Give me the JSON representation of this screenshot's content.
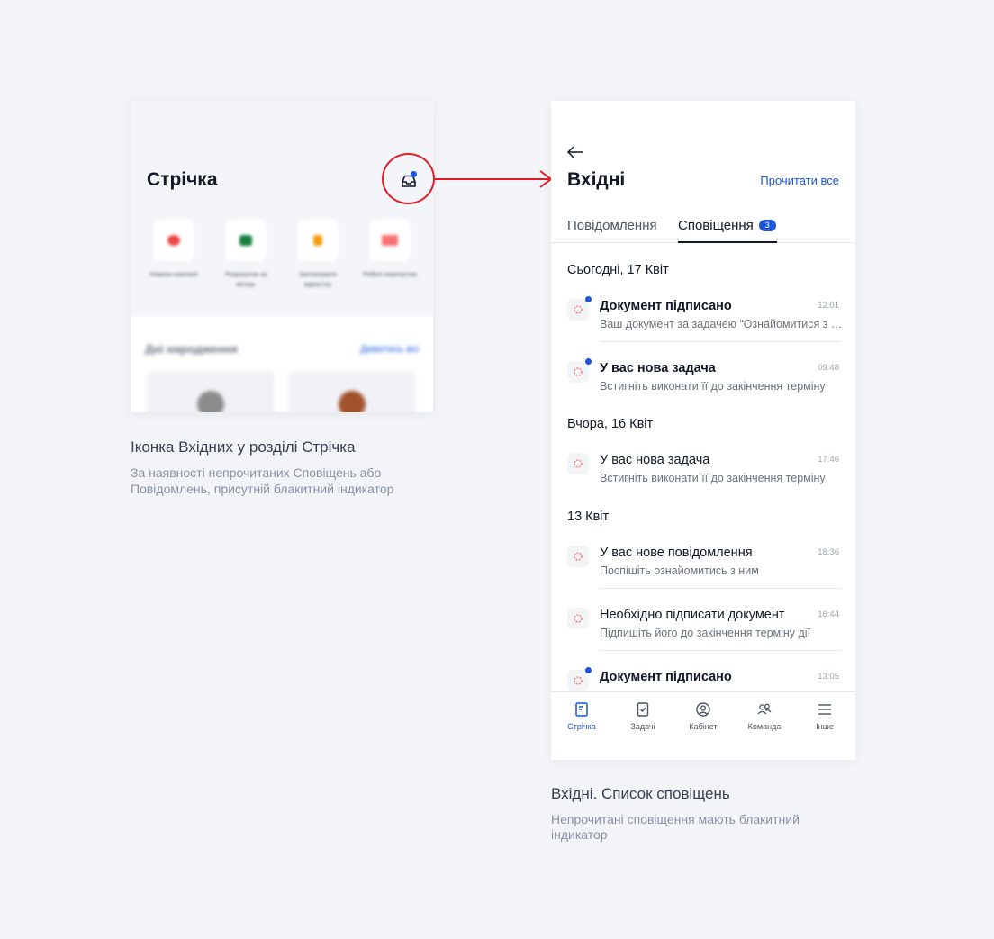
{
  "feed_preview": {
    "title": "Стрічка",
    "shortcuts": [
      {
        "label": "Новини компанії",
        "color": "#ef4444"
      },
      {
        "label": "Розрахунок за місяць",
        "color": "#15803d"
      },
      {
        "label": "Запланувати відпустку",
        "color": "#f59e0b"
      },
      {
        "label": "Робочі перепустки",
        "color": "#ef4444"
      }
    ],
    "section_title": "Дні народження",
    "section_link": "Дивитись всі"
  },
  "captions": {
    "left_title": "Іконка Вхідних у розділі Стрічка",
    "left_text_1": "За наявності непрочитаних Сповіщень або",
    "left_text_2": "Повідомлень, присутній блакитний індикатор",
    "right_title": "Вхідні. Список сповіщень",
    "right_text_1": "Непрочитані сповіщення мають блакитний",
    "right_text_2": "індикатор"
  },
  "inbox": {
    "title": "Вхідні",
    "mark_all_read": "Прочитати все",
    "tabs": [
      {
        "label": "Повідомлення"
      },
      {
        "label": "Сповіщення",
        "badge": "3"
      }
    ],
    "groups": [
      {
        "title": "Сьогодні, 17 Квіт"
      },
      {
        "title": "Вчора, 16 Квіт"
      },
      {
        "title": "13 Квіт"
      }
    ],
    "notifications": [
      {
        "title": "Документ підписано",
        "text": "Ваш документ за задачею “Ознайомитися з документом”",
        "time": "12:01",
        "unread": true
      },
      {
        "title": "У вас нова задача",
        "text": "Встигніть виконати її до закінчення терміну",
        "time": "09:48",
        "unread": true
      },
      {
        "title": "У вас нова задача",
        "text": "Встигніть виконати її до закінчення терміну",
        "time": "17:46",
        "unread": false
      },
      {
        "title": "У вас нове повідомлення",
        "text": "Поспішіть ознайомитись з ним",
        "time": "18:36",
        "unread": false
      },
      {
        "title": "Необхідно підписати документ",
        "text": "Підпишіть його до закінчення терміну дії",
        "time": "16:44",
        "unread": false
      },
      {
        "title": "Документ підписано",
        "text": "",
        "time": "13:05",
        "unread": true
      }
    ],
    "nav": [
      {
        "label": "Стрічка",
        "icon": "feed-icon",
        "active": true
      },
      {
        "label": "Задачі",
        "icon": "tasks-icon",
        "active": false
      },
      {
        "label": "Кабінет",
        "icon": "profile-icon",
        "active": false
      },
      {
        "label": "Команда",
        "icon": "team-icon",
        "active": false
      },
      {
        "label": "Інше",
        "icon": "menu-icon",
        "active": false
      }
    ]
  },
  "colors": {
    "accent": "#1a56db",
    "highlight": "#e11d2a",
    "background": "#f2f4f7"
  }
}
